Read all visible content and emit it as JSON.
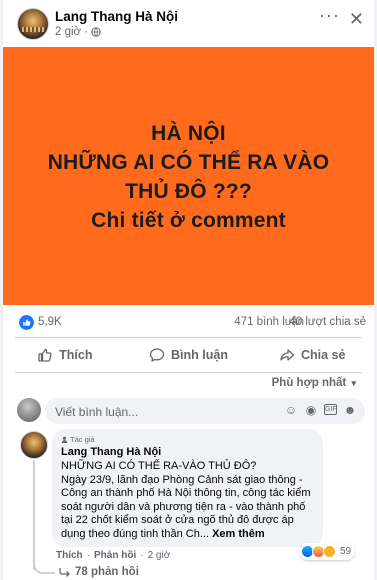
{
  "post": {
    "page_name": "Lang Thang Hà Nội",
    "time": "2 giờ",
    "separator": "·",
    "privacy_icon": "globe-icon",
    "more_icon": "more-icon",
    "close_icon": "close-icon",
    "banner_color": "#ff6a1c",
    "banner_lines": [
      "HÀ NỘI",
      "NHỮNG AI CÓ THỂ RA VÀO",
      "THỦ ĐÔ ???",
      "Chi tiết ở comment"
    ]
  },
  "stats": {
    "likes": "5,9K",
    "comments": "471 bình luận",
    "shares": "40 lượt chia sẻ"
  },
  "actions": {
    "like": "Thích",
    "comment": "Bình luận",
    "share": "Chia sẻ"
  },
  "sort": {
    "label": "Phù hợp nhất",
    "chevron": "▾"
  },
  "composer": {
    "placeholder": "Viết bình luận...",
    "icons": [
      "emoji-icon",
      "camera-icon",
      "gif-icon",
      "sticker-icon"
    ]
  },
  "comment": {
    "author_tag": "Tác giả",
    "author": "Lang Thang Hà Nội",
    "lines": [
      "NHỮNG AI CÓ THỂ RA-VÀO THỦ ĐÔ?",
      "Ngày 23/9, lãnh đạo Phòng Cảnh sát giao thông - Công an thành phố Hà Nội thông tin, công tác kiểm soát người dân và phương tiện ra - vào thành phố tại 22 chốt kiểm soát ở cửa ngõ thủ đô được áp dụng theo đúng tinh thần Ch..."
    ],
    "see_more": "Xem thêm",
    "like_label": "Thích",
    "reply_label": "Phản hồi",
    "time": "2 giờ",
    "dot": "·",
    "reaction_count": "59",
    "replies": "78 phản hồi"
  },
  "colors": {
    "accent": "#1877f2",
    "text_secondary": "#65676b",
    "bubble": "#f0f2f5"
  }
}
